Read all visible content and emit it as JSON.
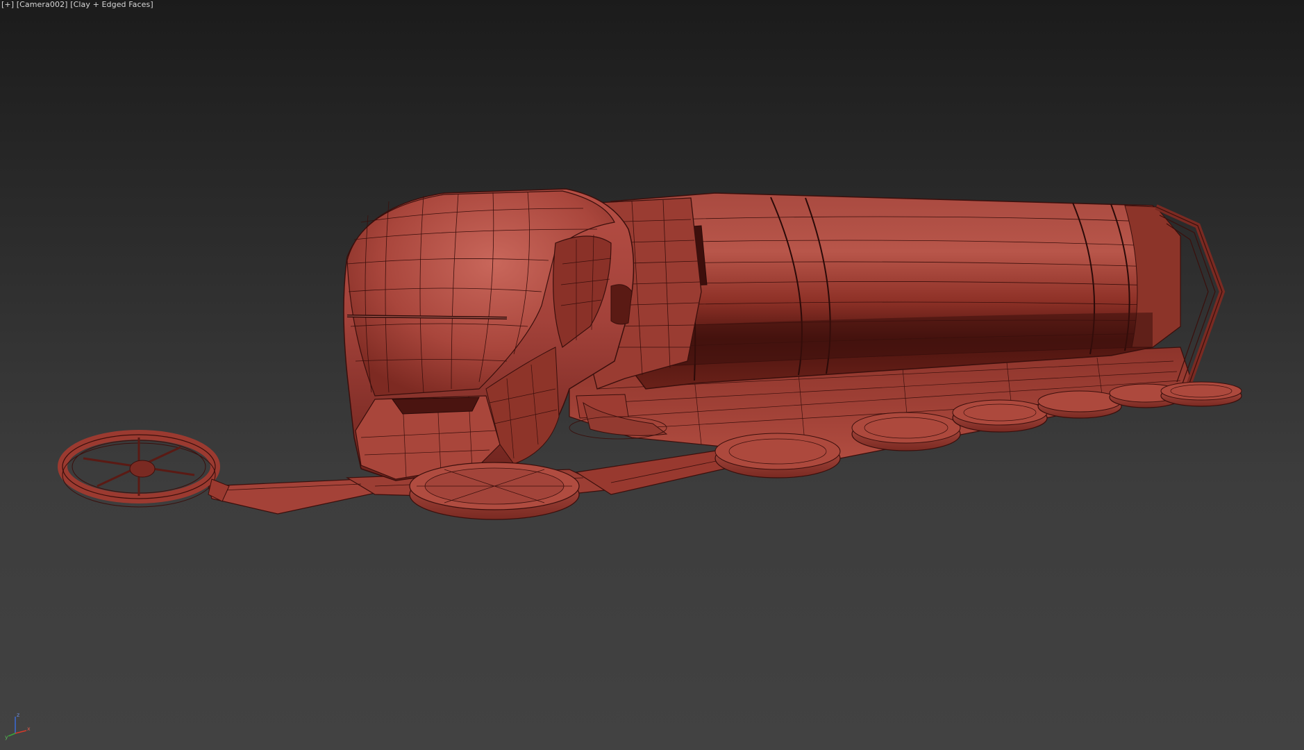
{
  "viewport": {
    "menu_label": "[+]",
    "camera_label": "[Camera002]",
    "shading_label": "[Clay + Edged Faces]"
  },
  "axis": {
    "x_label": "x",
    "y_label": "y",
    "z_label": "z",
    "x_color": "#d83a2a",
    "y_color": "#3aa83a",
    "z_color": "#3a6ad8"
  },
  "colors": {
    "clay_light": "#c0564a",
    "clay_mid": "#a8443a",
    "clay_dark": "#7a2a22",
    "clay_shadow": "#4a1410",
    "edge_wire": "#3a0f0c"
  }
}
